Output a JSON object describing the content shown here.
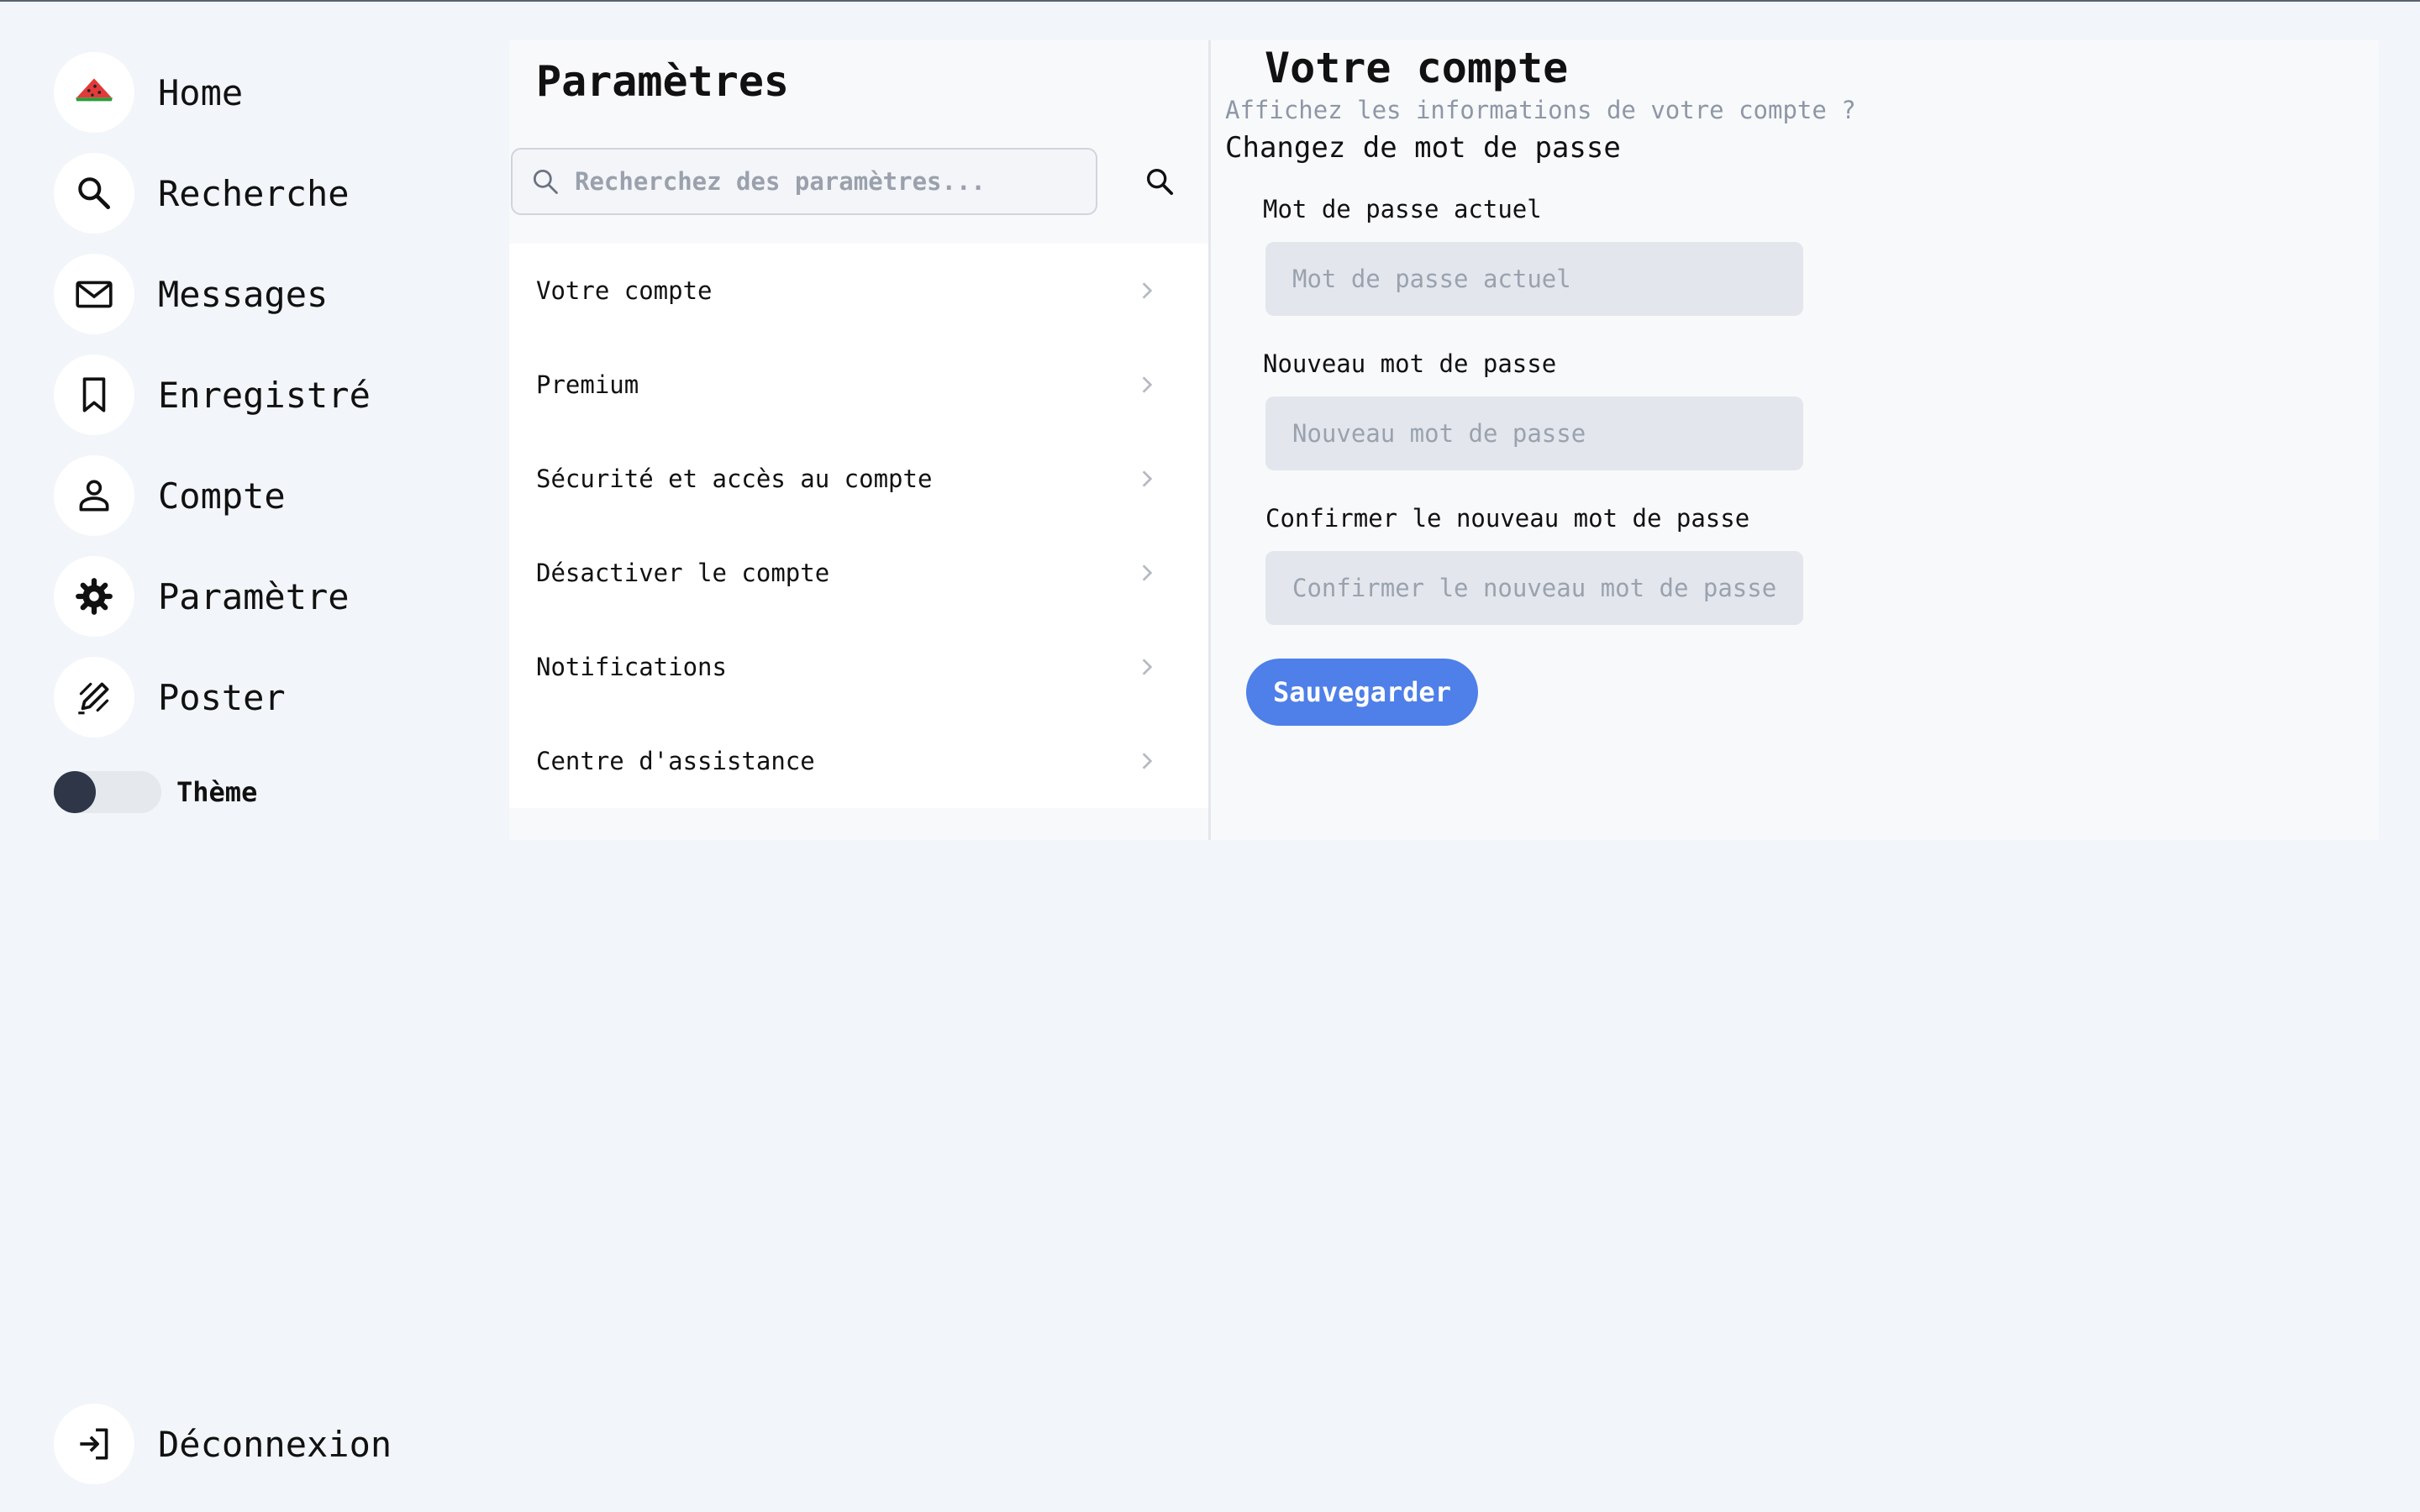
{
  "nav": {
    "items": [
      {
        "label": "Home",
        "icon": "watermelon-logo-icon"
      },
      {
        "label": "Recherche",
        "icon": "search-icon"
      },
      {
        "label": "Messages",
        "icon": "mail-icon"
      },
      {
        "label": "Enregistré",
        "icon": "bookmark-icon"
      },
      {
        "label": "Compte",
        "icon": "person-icon"
      },
      {
        "label": "Paramètre",
        "icon": "gear-icon"
      },
      {
        "label": "Poster",
        "icon": "pen-icon"
      }
    ],
    "theme_label": "Thème",
    "theme_dark": false,
    "logout_label": "Déconnexion",
    "logout_icon": "logout-icon"
  },
  "settings": {
    "title": "Paramètres",
    "search_placeholder": "Recherchez des paramètres...",
    "items": [
      {
        "label": "Votre compte"
      },
      {
        "label": "Premium"
      },
      {
        "label": "Sécurité et accès au compte"
      },
      {
        "label": "Désactiver le compte"
      },
      {
        "label": "Notifications"
      },
      {
        "label": "Centre d'assistance"
      }
    ]
  },
  "account": {
    "title": "Votre compte",
    "subtitle": "Affichez les informations de votre compte ?",
    "section_title": "Changez de mot de passe",
    "fields": [
      {
        "label": "Mot de passe actuel",
        "placeholder": "Mot de passe actuel",
        "value": ""
      },
      {
        "label": "Nouveau mot de passe",
        "placeholder": "Nouveau mot de passe",
        "value": ""
      },
      {
        "label": "Confirmer le nouveau mot de passe",
        "placeholder": "Confirmer le nouveau mot de passe",
        "value": ""
      }
    ],
    "save_label": "Sauvegarder"
  },
  "colors": {
    "page_bg": "#f2f5f9",
    "panel_bg": "#f8f9fb",
    "accent": "#4f7fe8",
    "input_bg": "#e3e7ed",
    "toggle_knob": "#2e3648"
  }
}
